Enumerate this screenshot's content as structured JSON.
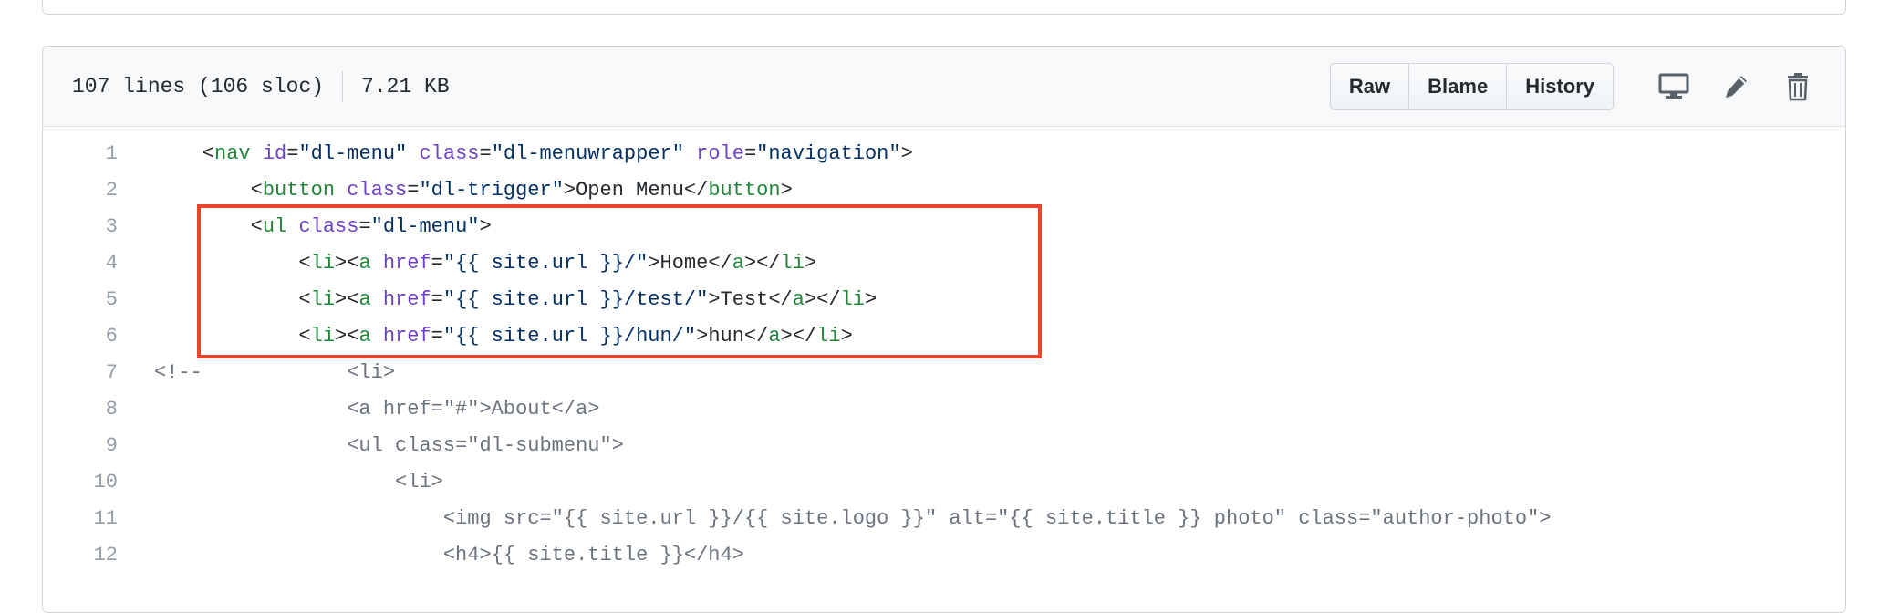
{
  "file_info": {
    "lines": "107 lines (106 sloc)",
    "size": "7.21 KB"
  },
  "buttons": {
    "raw": "Raw",
    "blame": "Blame",
    "history": "History"
  },
  "icons": [
    "desktop-icon",
    "pencil-icon",
    "trash-icon"
  ],
  "colors": {
    "tag": "#22863a",
    "attr": "#6f42c1",
    "string": "#032f62",
    "comment": "#6a737d",
    "highlight_border": "#e8462c"
  },
  "code_lines": [
    {
      "n": "1",
      "segs": [
        [
          "pl",
          "    <"
        ],
        [
          "tag",
          "nav"
        ],
        [
          "pl",
          " "
        ],
        [
          "attr",
          "id"
        ],
        [
          "pl",
          "="
        ],
        [
          "str",
          "\"dl-menu\""
        ],
        [
          "pl",
          " "
        ],
        [
          "attr",
          "class"
        ],
        [
          "pl",
          "="
        ],
        [
          "str",
          "\"dl-menuwrapper\""
        ],
        [
          "pl",
          " "
        ],
        [
          "attr",
          "role"
        ],
        [
          "pl",
          "="
        ],
        [
          "str",
          "\"navigation\""
        ],
        [
          "pl",
          ">"
        ]
      ]
    },
    {
      "n": "2",
      "segs": [
        [
          "pl",
          "        <"
        ],
        [
          "tag",
          "button"
        ],
        [
          "pl",
          " "
        ],
        [
          "attr",
          "class"
        ],
        [
          "pl",
          "="
        ],
        [
          "str",
          "\"dl-trigger\""
        ],
        [
          "pl",
          ">Open Menu</"
        ],
        [
          "tag",
          "button"
        ],
        [
          "pl",
          ">"
        ]
      ]
    },
    {
      "n": "3",
      "segs": [
        [
          "pl",
          "        <"
        ],
        [
          "tag",
          "ul"
        ],
        [
          "pl",
          " "
        ],
        [
          "attr",
          "class"
        ],
        [
          "pl",
          "="
        ],
        [
          "str",
          "\"dl-menu\""
        ],
        [
          "pl",
          ">"
        ]
      ]
    },
    {
      "n": "4",
      "segs": [
        [
          "pl",
          "            <"
        ],
        [
          "tag",
          "li"
        ],
        [
          "pl",
          "><"
        ],
        [
          "tag",
          "a"
        ],
        [
          "pl",
          " "
        ],
        [
          "attr",
          "href"
        ],
        [
          "pl",
          "="
        ],
        [
          "str",
          "\"{{ site.url }}/\""
        ],
        [
          "pl",
          ">Home</"
        ],
        [
          "tag",
          "a"
        ],
        [
          "pl",
          "></"
        ],
        [
          "tag",
          "li"
        ],
        [
          "pl",
          ">"
        ]
      ]
    },
    {
      "n": "5",
      "segs": [
        [
          "pl",
          "            <"
        ],
        [
          "tag",
          "li"
        ],
        [
          "pl",
          "><"
        ],
        [
          "tag",
          "a"
        ],
        [
          "pl",
          " "
        ],
        [
          "attr",
          "href"
        ],
        [
          "pl",
          "="
        ],
        [
          "str",
          "\"{{ site.url }}/test/\""
        ],
        [
          "pl",
          ">Test</"
        ],
        [
          "tag",
          "a"
        ],
        [
          "pl",
          "></"
        ],
        [
          "tag",
          "li"
        ],
        [
          "pl",
          ">"
        ]
      ]
    },
    {
      "n": "6",
      "segs": [
        [
          "pl",
          "            <"
        ],
        [
          "tag",
          "li"
        ],
        [
          "pl",
          "><"
        ],
        [
          "tag",
          "a"
        ],
        [
          "pl",
          " "
        ],
        [
          "attr",
          "href"
        ],
        [
          "pl",
          "="
        ],
        [
          "str",
          "\"{{ site.url }}/hun/\""
        ],
        [
          "pl",
          ">hun</"
        ],
        [
          "tag",
          "a"
        ],
        [
          "pl",
          "></"
        ],
        [
          "tag",
          "li"
        ],
        [
          "pl",
          ">"
        ]
      ]
    },
    {
      "n": "7",
      "segs": [
        [
          "cm",
          "<!--            <li>"
        ]
      ]
    },
    {
      "n": "8",
      "segs": [
        [
          "cm",
          "                <a href=\"#\">About</a>"
        ]
      ]
    },
    {
      "n": "9",
      "segs": [
        [
          "cm",
          "                <ul class=\"dl-submenu\">"
        ]
      ]
    },
    {
      "n": "10",
      "segs": [
        [
          "cm",
          "                    <li>"
        ]
      ]
    },
    {
      "n": "11",
      "segs": [
        [
          "cm",
          "                        <img src=\"{{ site.url }}/{{ site.logo }}\" alt=\"{{ site.title }} photo\" class=\"author-photo\">"
        ]
      ]
    },
    {
      "n": "12",
      "segs": [
        [
          "cm",
          "                        <h4>{{ site.title }}</h4>"
        ]
      ]
    }
  ]
}
